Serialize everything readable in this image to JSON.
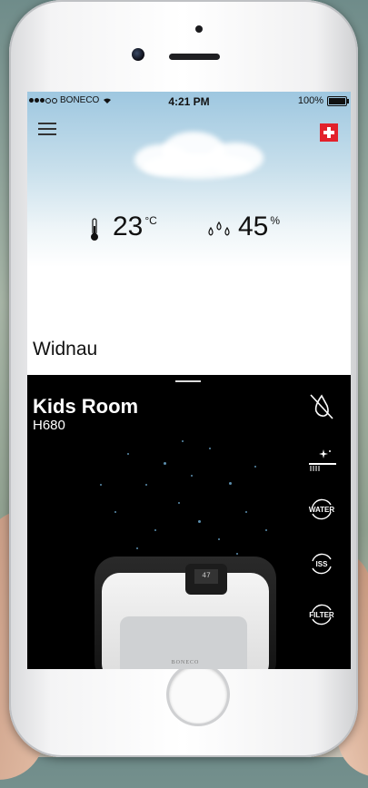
{
  "status_bar": {
    "carrier": "BONECO",
    "time": "4:21 PM",
    "battery": "100%"
  },
  "weather": {
    "temperature": "23",
    "temperature_unit": "°C",
    "humidity": "45",
    "humidity_unit": "%",
    "city": "Widnau"
  },
  "icons": {
    "menu": "menu-icon",
    "flag": "swiss-flag-icon",
    "thermometer": "thermometer-icon",
    "humidity": "humidity-drops-icon"
  },
  "device": {
    "room": "Kids Room",
    "model": "H680",
    "brand_label": "BONECO",
    "display": "47"
  },
  "controls": [
    {
      "name": "no-water-icon",
      "label": ""
    },
    {
      "name": "ionizer-brush-icon",
      "label": ""
    },
    {
      "name": "water-refresh-icon",
      "label": "WATER"
    },
    {
      "name": "iss-refresh-icon",
      "label": "ISS"
    },
    {
      "name": "filter-refresh-icon",
      "label": "FILTER"
    }
  ],
  "colors": {
    "flag_red": "#e2212b",
    "sky_top": "#9ec7e0",
    "room_bg": "#000000",
    "particle": "#5c8fae"
  }
}
